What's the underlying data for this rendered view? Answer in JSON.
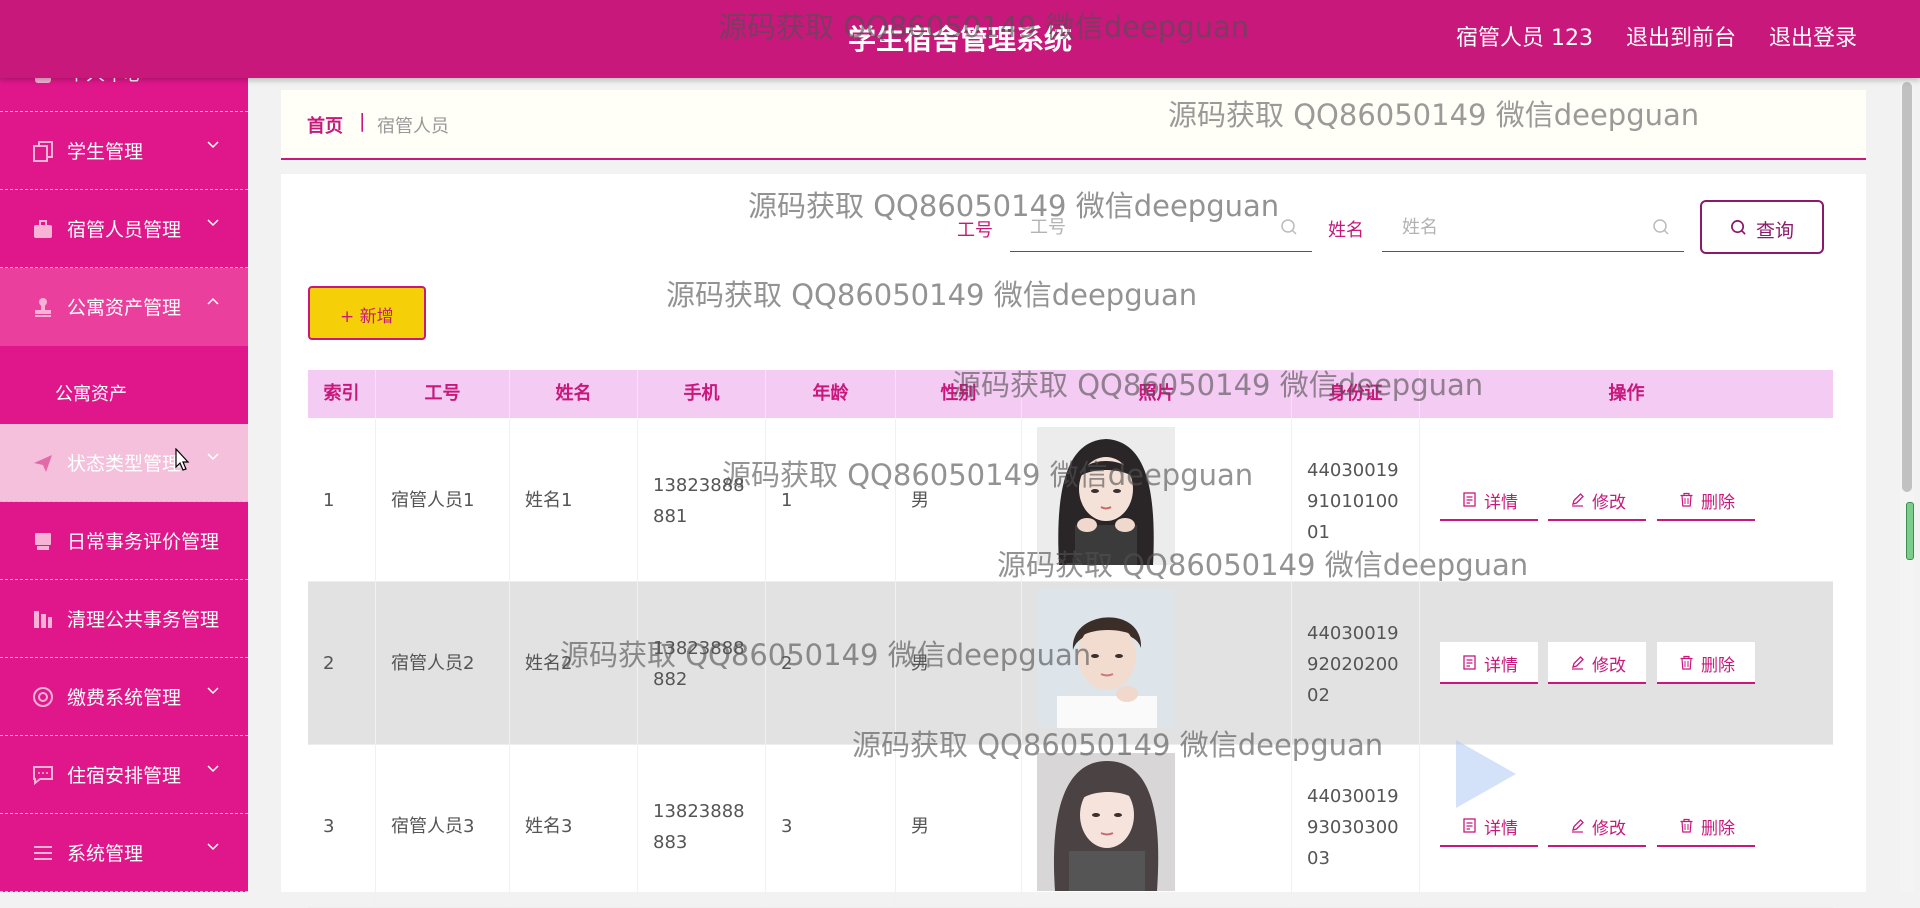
{
  "header": {
    "title": "学生宿舍管理系统",
    "user": "宿管人员 123",
    "front_link": "退出到前台",
    "logout": "退出登录"
  },
  "sidebar": {
    "items": [
      {
        "label": "个人中心",
        "icon": "user-icon"
      },
      {
        "label": "学生管理",
        "icon": "copy-icon"
      },
      {
        "label": "宿管人员管理",
        "icon": "briefcase-icon"
      },
      {
        "label": "公寓资产管理",
        "icon": "stamp-icon",
        "open": true
      },
      {
        "label": "状态类型管理",
        "icon": "send-icon"
      },
      {
        "label": "日常事务评价管理",
        "icon": "monitor-icon"
      },
      {
        "label": "清理公共事务管理",
        "icon": "building-icon"
      },
      {
        "label": "缴费系统管理",
        "icon": "lifebuoy-icon"
      },
      {
        "label": "住宿安排管理",
        "icon": "chat-icon"
      },
      {
        "label": "系统管理",
        "icon": "list-icon"
      }
    ],
    "sub_item": "公寓资产"
  },
  "breadcrumb": {
    "home": "首页",
    "separator": "|",
    "current": "宿管人员"
  },
  "search": {
    "job_label": "工号",
    "job_placeholder": "工号",
    "name_label": "姓名",
    "name_placeholder": "姓名",
    "query_button": "查询"
  },
  "add_button": "新增",
  "table": {
    "headers": [
      "索引",
      "工号",
      "姓名",
      "手机",
      "年龄",
      "性别",
      "照片",
      "身份证",
      "操作"
    ],
    "rows": [
      {
        "index": "1",
        "job_no": "宿管人员1",
        "name": "姓名1",
        "phone": "13823888881",
        "age": "1",
        "gender": "男",
        "id_card": "440300199101010001"
      },
      {
        "index": "2",
        "job_no": "宿管人员2",
        "name": "姓名2",
        "phone": "13823888882",
        "age": "2",
        "gender": "男",
        "id_card": "440300199202020002"
      },
      {
        "index": "3",
        "job_no": "宿管人员3",
        "name": "姓名3",
        "phone": "13823888883",
        "age": "3",
        "gender": "男",
        "id_card": "440300199303030003"
      }
    ],
    "actions": {
      "detail": "详情",
      "edit": "修改",
      "delete": "删除"
    }
  },
  "watermark": "源码获取 QQ86050149 微信deepguan",
  "colors": {
    "primary": "#c8187c",
    "sidebar": "#e0178b",
    "accent_yellow": "#f5cf08",
    "header_row": "#f3cbf3"
  }
}
